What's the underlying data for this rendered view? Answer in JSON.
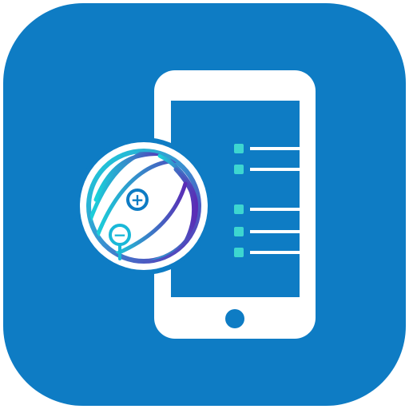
{
  "app_icon": {
    "icon_name": "mobile-device-globe-app-icon",
    "colors": {
      "background": "#0E7CC4",
      "phone": "#FFFFFF",
      "screen_rows": "#3DD6D0",
      "globe_cyan": "#19D3DA",
      "globe_purple": "#5B2BB5",
      "globe_fill": "#FFFFFF"
    },
    "symbols": {
      "plus": "+",
      "minus": "−"
    },
    "screen_rows": [
      {
        "row": 1
      },
      {
        "row": 2
      },
      {
        "row": 3
      },
      {
        "row": 4
      },
      {
        "row": 5
      }
    ]
  }
}
